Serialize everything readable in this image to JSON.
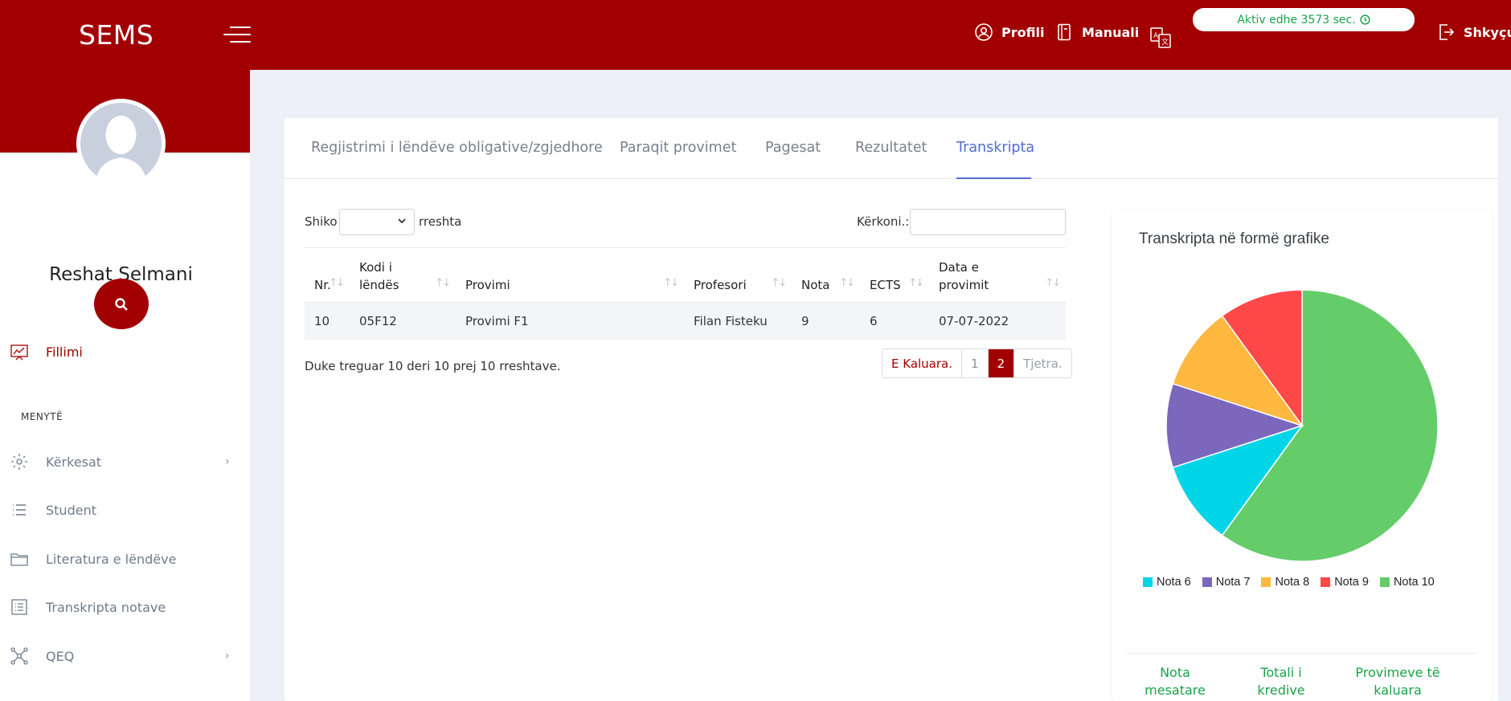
{
  "header": {
    "brand": "SEMS",
    "profile_label": "Profili",
    "manual_label": "Manuali",
    "session_text": "Aktiv edhe 3573 sec.",
    "logout_label": "Shkyçu"
  },
  "sidebar": {
    "user_name": "Reshat Selmani",
    "home_label": "Fillimi",
    "section_label": "MENYTË",
    "items": [
      {
        "label": "Kërkesat",
        "icon": "gear-icon",
        "has_submenu": true
      },
      {
        "label": "Student",
        "icon": "list-icon",
        "has_submenu": false
      },
      {
        "label": "Literatura e lëndëve",
        "icon": "folder-icon",
        "has_submenu": false
      },
      {
        "label": "Transkripta notave",
        "icon": "list-alt-icon",
        "has_submenu": false
      },
      {
        "label": "QEQ",
        "icon": "network-icon",
        "has_submenu": true
      }
    ]
  },
  "tabs": [
    {
      "label": "Regjistrimi i lëndëve obligative/zgjedhore",
      "active": false
    },
    {
      "label": "Paraqit provimet",
      "active": false
    },
    {
      "label": "Pagesat",
      "active": false
    },
    {
      "label": "Rezultatet",
      "active": false
    },
    {
      "label": "Transkripta",
      "active": true
    }
  ],
  "table_controls": {
    "show_label": "Shiko",
    "rows_label": "rreshta",
    "search_label": "Kërkoni.:"
  },
  "table": {
    "columns": [
      {
        "label": "Nr."
      },
      {
        "label": "Kodi i lëndës"
      },
      {
        "label": "Provimi"
      },
      {
        "label": "Profesori"
      },
      {
        "label": "Nota"
      },
      {
        "label": "ECTS"
      },
      {
        "label": "Data e provimit"
      }
    ],
    "rows": [
      [
        "10",
        "05F12",
        "Provimi F1",
        "Filan Fisteku",
        "9",
        "6",
        "07-07-2022"
      ]
    ]
  },
  "pagination": {
    "info": "Duke treguar 10 deri 10 prej 10 rreshtave.",
    "prev_label": "E Kaluara.",
    "pages": [
      "1",
      "2"
    ],
    "active_page": "2",
    "next_label": "Tjetra."
  },
  "chart_data": {
    "type": "pie",
    "title": "Transkripta në formë grafike",
    "categories": [
      "Nota 6",
      "Nota 7",
      "Nota 8",
      "Nota 9",
      "Nota 10"
    ],
    "values": [
      1,
      1,
      1,
      1,
      6
    ],
    "colors": [
      "#00d5e8",
      "#7b68bd",
      "#ffb840",
      "#ff4848",
      "#65cc6a"
    ],
    "legend_position": "bottom"
  },
  "stats": [
    {
      "label": "Nota mesatare"
    },
    {
      "label": "Totali i kredive"
    },
    {
      "label": "Provimeve të kaluara"
    }
  ],
  "colors": {
    "brand": "#a20000",
    "active_tab": "#4f6bd6",
    "success": "#1aa34a"
  }
}
